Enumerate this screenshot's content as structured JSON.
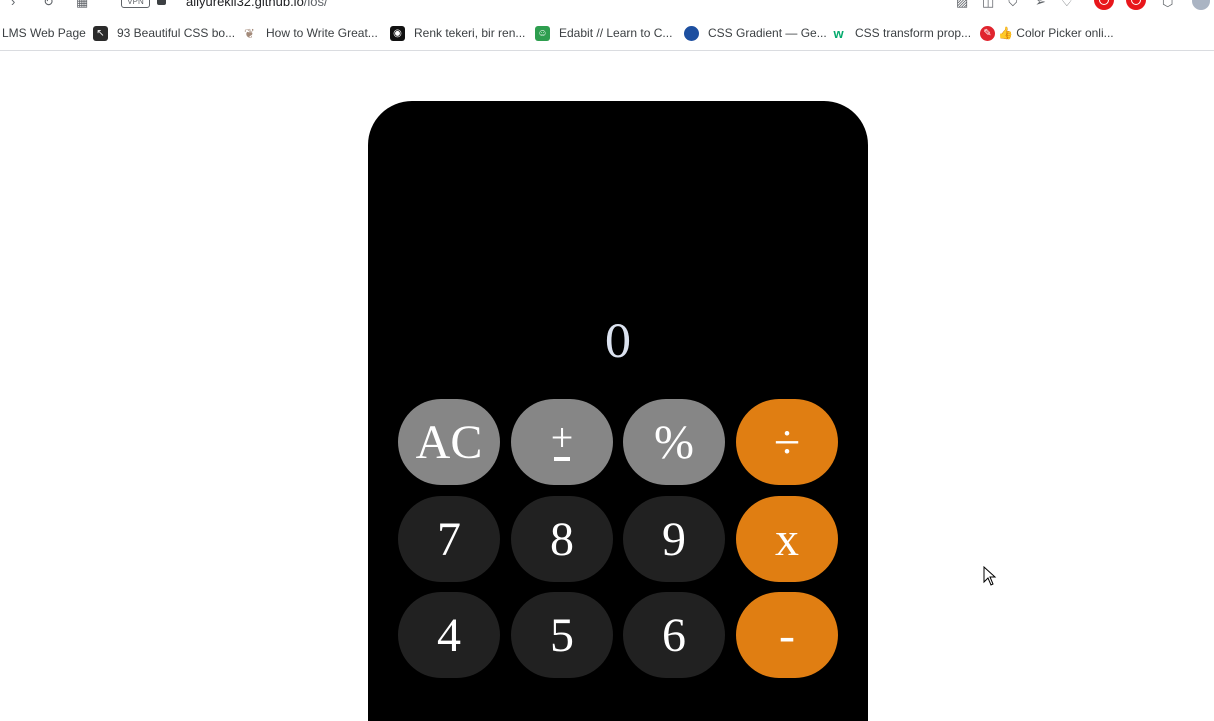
{
  "browser": {
    "vpn_label": "VPN",
    "url_domain": "aliyurekli32.github.io",
    "url_path": "/ios/"
  },
  "bookmarks": [
    {
      "label": "LMS Web Page",
      "icon": "none",
      "color": ""
    },
    {
      "label": "93 Beautiful CSS bo...",
      "icon": "cursor-favicon",
      "color": "#2b2b2b"
    },
    {
      "label": "How to Write Great...",
      "icon": "leaf-favicon",
      "color": "#a38a7a"
    },
    {
      "label": "Renk tekeri, bir ren...",
      "icon": "color-wheel-favicon",
      "color": "#111111"
    },
    {
      "label": "Edabit // Learn to C...",
      "icon": "edabit-favicon",
      "color": "#2e9e4f"
    },
    {
      "label": "CSS Gradient — Ge...",
      "icon": "gradient-favicon",
      "color": "#1d4fa0"
    },
    {
      "label": "CSS transform prop...",
      "icon": "w3schools-favicon",
      "color": "#04aa6d"
    },
    {
      "label": "👍 Color Picker onli...",
      "icon": "picker-favicon",
      "color": "#e0242e"
    }
  ],
  "calculator": {
    "display_value": "0",
    "keys": {
      "ac": "AC",
      "plus_minus_top": "+",
      "percent": "%",
      "divide": "÷",
      "seven": "7",
      "eight": "8",
      "nine": "9",
      "multiply": "x",
      "four": "4",
      "five": "5",
      "six": "6",
      "subtract": "-"
    },
    "colors": {
      "body": "#000000",
      "function_key": "#868686",
      "digit_key": "#212121",
      "operator_key": "#e07e12",
      "display_text": "#dbe2ef"
    }
  }
}
